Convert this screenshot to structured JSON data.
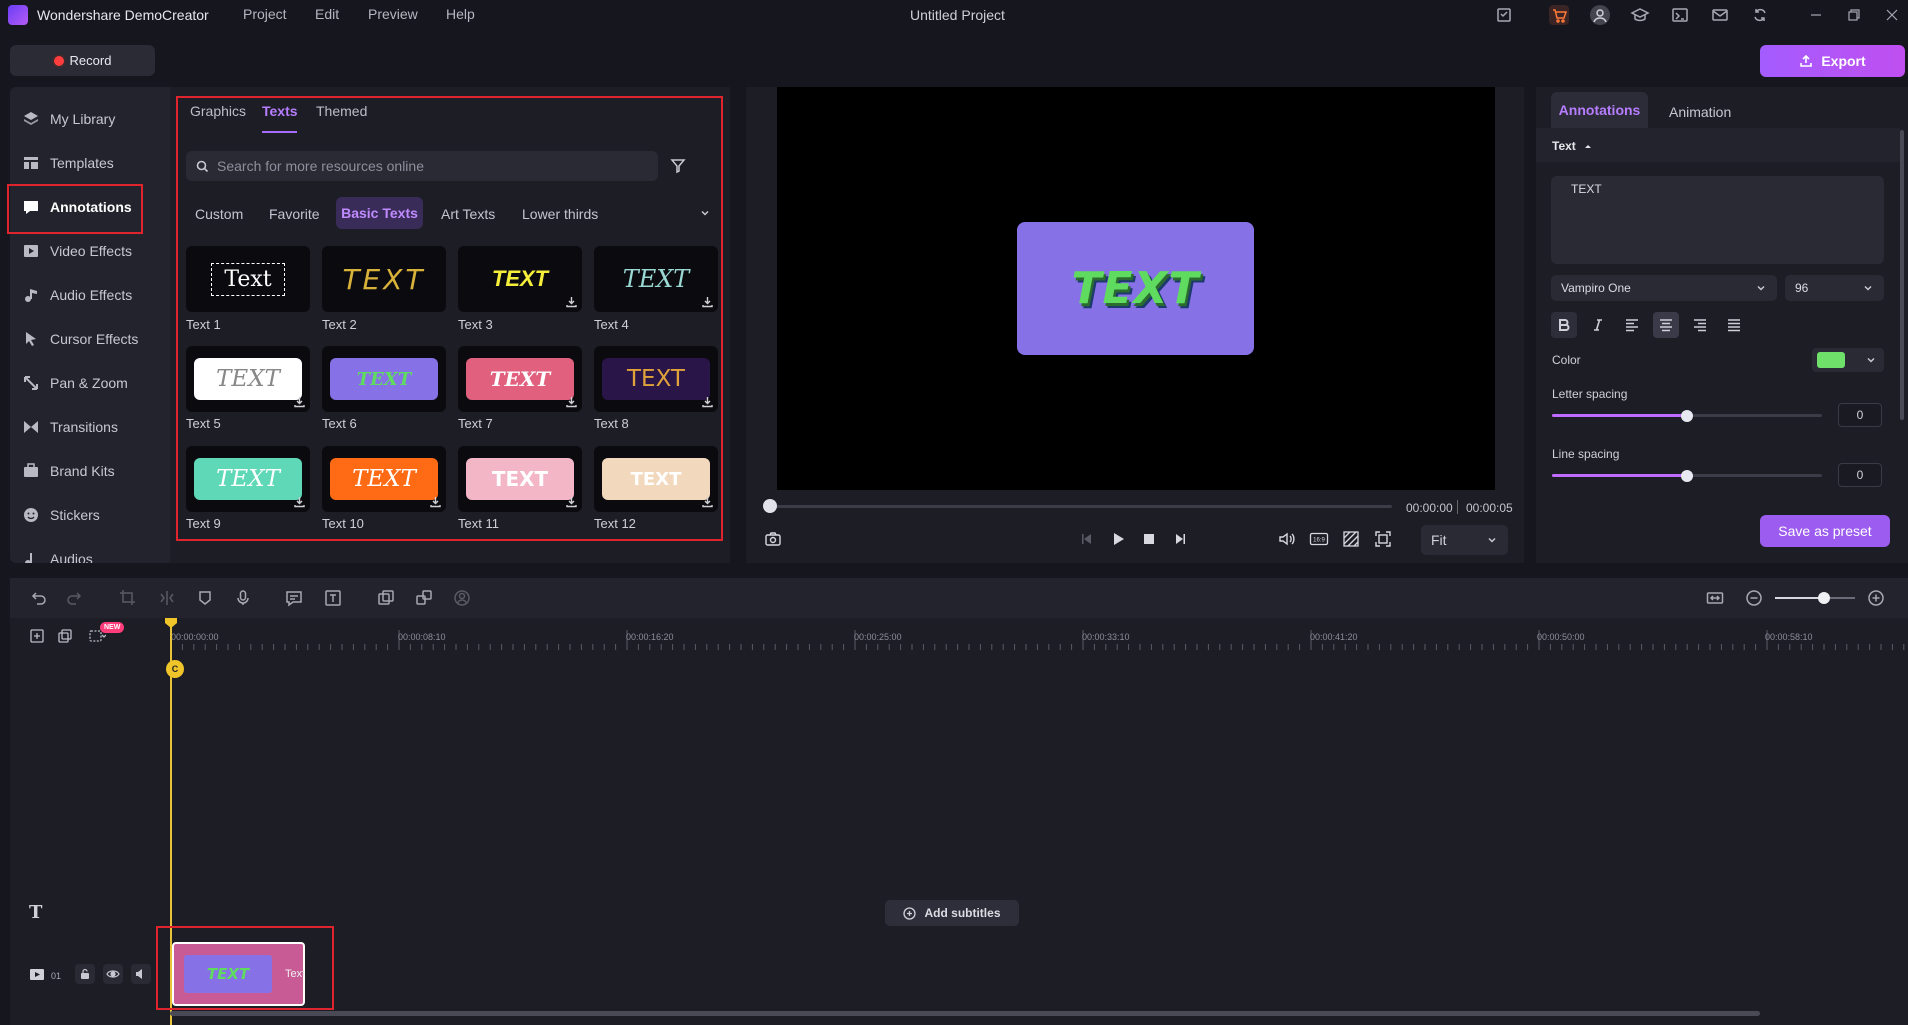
{
  "app": {
    "name": "Wondershare DemoCreator",
    "project_title": "Untitled Project",
    "menu": [
      "Project",
      "Edit",
      "Preview",
      "Help"
    ],
    "titlebar_icons": [
      "notes-icon",
      "cart-icon",
      "account-icon",
      "learn-icon",
      "feedback-icon",
      "mail-icon",
      "sync-icon",
      "minimize-icon",
      "restore-icon",
      "close-icon"
    ]
  },
  "toolbar": {
    "record_label": "Record",
    "export_label": "Export"
  },
  "sidebar": {
    "items": [
      {
        "label": "My Library",
        "icon": "layers-icon"
      },
      {
        "label": "Templates",
        "icon": "template-icon"
      },
      {
        "label": "Annotations",
        "icon": "annotation-icon",
        "active": true
      },
      {
        "label": "Video Effects",
        "icon": "video-effects-icon"
      },
      {
        "label": "Audio Effects",
        "icon": "audio-effects-icon"
      },
      {
        "label": "Cursor Effects",
        "icon": "cursor-icon"
      },
      {
        "label": "Pan & Zoom",
        "icon": "pan-zoom-icon"
      },
      {
        "label": "Transitions",
        "icon": "transitions-icon"
      },
      {
        "label": "Brand Kits",
        "icon": "brand-kit-icon"
      },
      {
        "label": "Stickers",
        "icon": "sticker-icon"
      },
      {
        "label": "Audios",
        "icon": "audio-icon"
      }
    ]
  },
  "library": {
    "tabs": [
      {
        "label": "Graphics"
      },
      {
        "label": "Texts",
        "active": true
      },
      {
        "label": "Themed"
      }
    ],
    "search_placeholder": "Search for more resources online",
    "categories": [
      {
        "label": "Custom"
      },
      {
        "label": "Favorite"
      },
      {
        "label": "Basic Texts",
        "active": true
      },
      {
        "label": "Art Texts"
      },
      {
        "label": "Lower thirds"
      }
    ],
    "items": [
      {
        "label": "Text 1",
        "preview": "Text"
      },
      {
        "label": "Text 2",
        "preview": "TEXT"
      },
      {
        "label": "Text 3",
        "preview": "TEXT"
      },
      {
        "label": "Text 4",
        "preview": "TEXT"
      },
      {
        "label": "Text 5",
        "preview": "TEXT"
      },
      {
        "label": "Text 6",
        "preview": "TEXT"
      },
      {
        "label": "Text 7",
        "preview": "TEXT"
      },
      {
        "label": "Text 8",
        "preview": "TEXT"
      },
      {
        "label": "Text 9",
        "preview": "TEXT"
      },
      {
        "label": "Text 10",
        "preview": "TEXT"
      },
      {
        "label": "Text 11",
        "preview": "TEXT"
      },
      {
        "label": "Text 12",
        "preview": "TEXT"
      }
    ]
  },
  "preview": {
    "stage_text": "TEXT",
    "time_current": "00:00:00",
    "time_total": "00:00:05",
    "zoom_option": "Fit",
    "aspect_label": "16:9"
  },
  "properties": {
    "tabs": [
      {
        "label": "Annotations",
        "active": true
      },
      {
        "label": "Animation"
      }
    ],
    "section_label": "Text",
    "text_value": "TEXT",
    "font_family": "Vampiro One",
    "font_size": "96",
    "color_label": "Color",
    "color_value": "#6fe06a",
    "letter_spacing_label": "Letter spacing",
    "letter_spacing_value": "0",
    "line_spacing_label": "Line spacing",
    "line_spacing_value": "0",
    "save_preset_label": "Save as preset"
  },
  "timeline": {
    "ruler_labels": [
      "00:00:00:00",
      "00:00:08:10",
      "00:00:16:20",
      "00:00:25:00",
      "00:00:33:10",
      "00:00:41:20",
      "00:00:50:00",
      "00:00:58:10"
    ],
    "new_badge": "NEW",
    "add_subtitles_label": "Add subtitles",
    "track_number": "01",
    "clip_label": "Text",
    "clip_thumb_text": "TEXT",
    "playhead_marker": "C"
  },
  "colors": {
    "accent": "#a66bff",
    "highlight_border": "#e0242d",
    "background": "#16161e"
  }
}
